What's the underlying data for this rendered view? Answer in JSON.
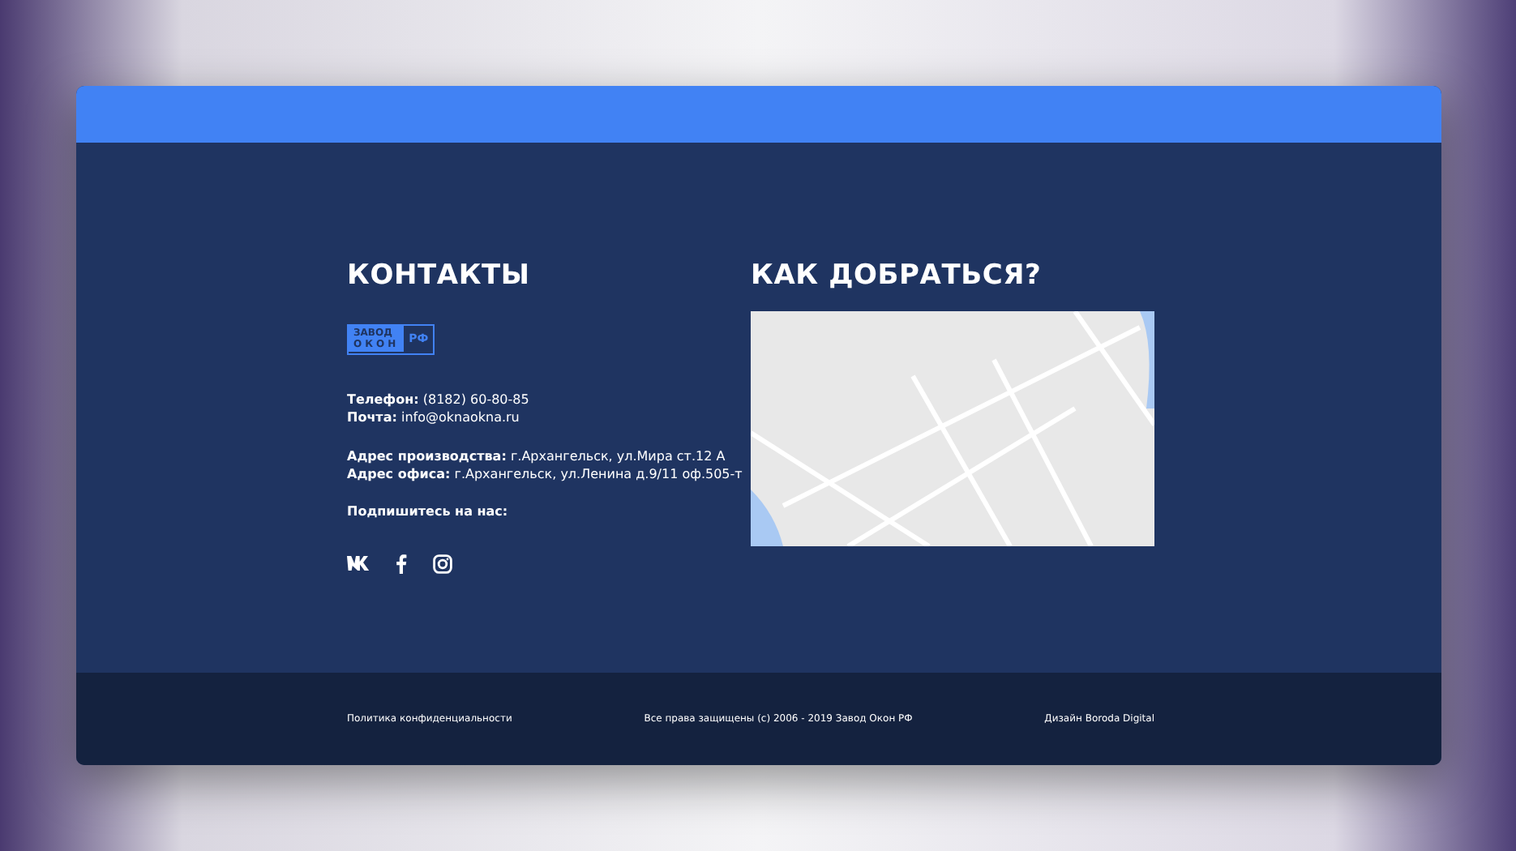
{
  "contacts": {
    "title": "КОНТАКТЫ",
    "logo": {
      "line_1": "ЗАВОД",
      "line_2": "ОКОН",
      "suffix": "РФ"
    },
    "groups": [
      [
        {
          "label": "Телефон:",
          "value": "(8182) 60-80-85"
        },
        {
          "label": "Почта:",
          "value": "info@oknaokna.ru"
        }
      ],
      [
        {
          "label": "Адрес производства:",
          "value": "г.Архангельск, ул.Мира ст.12 А"
        },
        {
          "label": "Адрес офиса:",
          "value": "г.Архангельск, ул.Ленина д.9/11 оф.505-т"
        }
      ]
    ],
    "subscribe": "Подпишитесь на нас:",
    "social": [
      {
        "kind": "vk"
      },
      {
        "kind": "facebook"
      },
      {
        "kind": "instagram"
      }
    ]
  },
  "directions": {
    "title": "КАК ДОБРАТЬСЯ?"
  },
  "footer": {
    "privacy": "Политика конфиденциальности",
    "copyright": "Все права защищены (c) 2006 - 2019 Завод Окон РФ",
    "credit": "Дизайн Boroda Digital"
  }
}
